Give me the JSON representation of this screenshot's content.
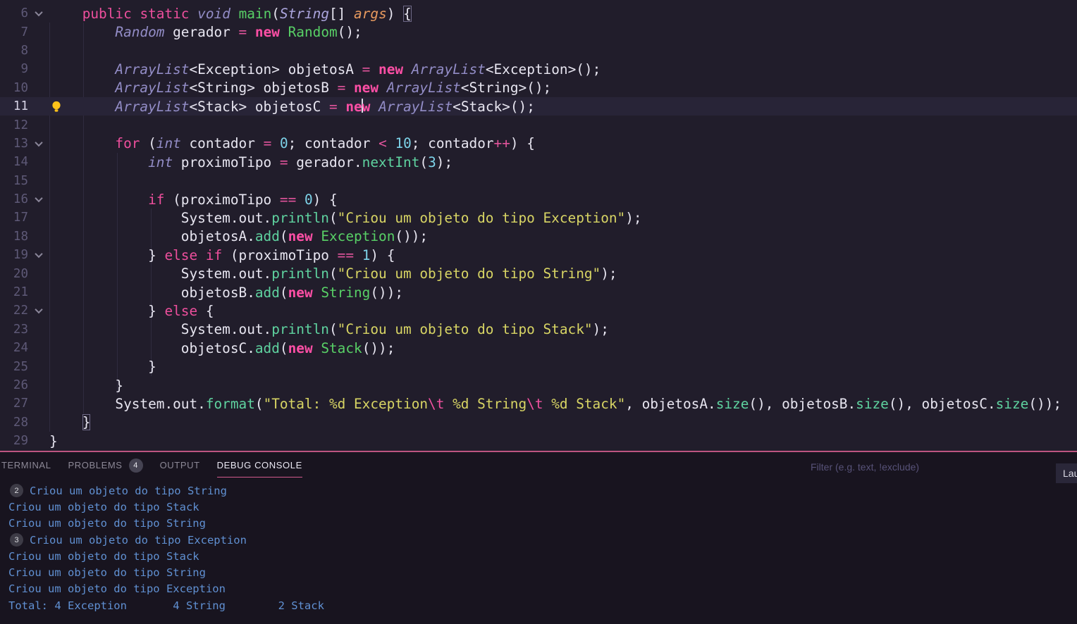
{
  "colors": {
    "editor_background": "#211d2b",
    "panel_background": "#18141f",
    "accent_pink": "#d15a8d",
    "panel_border_pink": "#bc5480",
    "keyword": "#ee4f9d",
    "keyword_bold": "#ff4fa6",
    "type_italic": "#938dc7",
    "function_green": "#58d066",
    "method_mint": "#5fd3a0",
    "string_yellow": "#d8d564",
    "number_cyan": "#7ed4ea",
    "console_text_blue": "#6090d2",
    "lightbulb_yellow": "#fdc21a"
  },
  "editor": {
    "lines": [
      {
        "num": "6",
        "fold": true,
        "segments": [
          [
            "    "
          ],
          [
            "public",
            "kw"
          ],
          [
            " "
          ],
          [
            "static",
            "kw"
          ],
          [
            " "
          ],
          [
            "void",
            "type"
          ],
          [
            " "
          ],
          [
            "main",
            "fn"
          ],
          [
            "("
          ],
          [
            "String",
            "type2"
          ],
          [
            "[]"
          ],
          [
            " "
          ],
          [
            "args",
            "param"
          ],
          [
            ")"
          ],
          [
            " "
          ],
          [
            "{",
            "boxed"
          ]
        ]
      },
      {
        "num": "7",
        "segments": [
          [
            "        "
          ],
          [
            "Random",
            "type"
          ],
          [
            " gerador "
          ],
          [
            "=",
            "op"
          ],
          [
            " "
          ],
          [
            "new",
            "kwb"
          ],
          [
            " "
          ],
          [
            "Random",
            "fn"
          ],
          [
            "();"
          ]
        ]
      },
      {
        "num": "8",
        "segments": []
      },
      {
        "num": "9",
        "segments": [
          [
            "        "
          ],
          [
            "ArrayList",
            "type"
          ],
          [
            "<Exception> objetosA "
          ],
          [
            "=",
            "op"
          ],
          [
            " "
          ],
          [
            "new",
            "kwb"
          ],
          [
            " "
          ],
          [
            "ArrayList",
            "type"
          ],
          [
            "<Exception>();"
          ]
        ]
      },
      {
        "num": "10",
        "segments": [
          [
            "        "
          ],
          [
            "ArrayList",
            "type"
          ],
          [
            "<String> objetosB "
          ],
          [
            "=",
            "op"
          ],
          [
            " "
          ],
          [
            "new",
            "kwb"
          ],
          [
            " "
          ],
          [
            "ArrayList",
            "type"
          ],
          [
            "<String>();"
          ]
        ]
      },
      {
        "num": "11",
        "active": true,
        "bulb": true,
        "segments": [
          [
            "        "
          ],
          [
            "ArrayList",
            "type"
          ],
          [
            "<Stack> objetosC "
          ],
          [
            "=",
            "op"
          ],
          [
            " "
          ],
          [
            "ne",
            "kwb"
          ],
          [
            "",
            "caret"
          ],
          [
            "w",
            "kwb"
          ],
          [
            " "
          ],
          [
            "ArrayList",
            "type"
          ],
          [
            "<Stack>();"
          ]
        ]
      },
      {
        "num": "12",
        "segments": []
      },
      {
        "num": "13",
        "fold": true,
        "segments": [
          [
            "        "
          ],
          [
            "for",
            "kw"
          ],
          [
            " ("
          ],
          [
            "int",
            "type"
          ],
          [
            " contador "
          ],
          [
            "=",
            "op"
          ],
          [
            " "
          ],
          [
            "0",
            "num"
          ],
          [
            "; contador "
          ],
          [
            "<",
            "op"
          ],
          [
            " "
          ],
          [
            "10",
            "num"
          ],
          [
            "; contador"
          ],
          [
            "++",
            "op"
          ],
          [
            ") {"
          ]
        ]
      },
      {
        "num": "14",
        "segments": [
          [
            "            "
          ],
          [
            "int",
            "type"
          ],
          [
            " proximoTipo "
          ],
          [
            "=",
            "op"
          ],
          [
            " gerador."
          ],
          [
            "nextInt",
            "mfn"
          ],
          [
            "("
          ],
          [
            "3",
            "num"
          ],
          [
            ");"
          ]
        ]
      },
      {
        "num": "15",
        "segments": []
      },
      {
        "num": "16",
        "fold": true,
        "segments": [
          [
            "            "
          ],
          [
            "if",
            "kw"
          ],
          [
            " (proximoTipo "
          ],
          [
            "==",
            "op"
          ],
          [
            " "
          ],
          [
            "0",
            "num"
          ],
          [
            ") {"
          ]
        ]
      },
      {
        "num": "17",
        "segments": [
          [
            "                "
          ],
          [
            "System.out."
          ],
          [
            "println",
            "mfn"
          ],
          [
            "("
          ],
          [
            "\"Criou um objeto do tipo Exception\"",
            "str"
          ],
          [
            ");"
          ]
        ]
      },
      {
        "num": "18",
        "segments": [
          [
            "                "
          ],
          [
            "objetosA."
          ],
          [
            "add",
            "mfn"
          ],
          [
            "("
          ],
          [
            "new",
            "kwb"
          ],
          [
            " "
          ],
          [
            "Exception",
            "fn"
          ],
          [
            "());"
          ]
        ]
      },
      {
        "num": "19",
        "fold": true,
        "segments": [
          [
            "            } "
          ],
          [
            "else",
            "kw"
          ],
          [
            " "
          ],
          [
            "if",
            "kw"
          ],
          [
            " (proximoTipo "
          ],
          [
            "==",
            "op"
          ],
          [
            " "
          ],
          [
            "1",
            "num"
          ],
          [
            ") {"
          ]
        ]
      },
      {
        "num": "20",
        "segments": [
          [
            "                "
          ],
          [
            "System.out."
          ],
          [
            "println",
            "mfn"
          ],
          [
            "("
          ],
          [
            "\"Criou um objeto do tipo String\"",
            "str"
          ],
          [
            ");"
          ]
        ]
      },
      {
        "num": "21",
        "segments": [
          [
            "                "
          ],
          [
            "objetosB."
          ],
          [
            "add",
            "mfn"
          ],
          [
            "("
          ],
          [
            "new",
            "kwb"
          ],
          [
            " "
          ],
          [
            "String",
            "fn"
          ],
          [
            "());"
          ]
        ]
      },
      {
        "num": "22",
        "fold": true,
        "segments": [
          [
            "            } "
          ],
          [
            "else",
            "kw"
          ],
          [
            " {"
          ]
        ]
      },
      {
        "num": "23",
        "segments": [
          [
            "                "
          ],
          [
            "System.out."
          ],
          [
            "println",
            "mfn"
          ],
          [
            "("
          ],
          [
            "\"Criou um objeto do tipo Stack\"",
            "str"
          ],
          [
            ");"
          ]
        ]
      },
      {
        "num": "24",
        "segments": [
          [
            "                "
          ],
          [
            "objetosC."
          ],
          [
            "add",
            "mfn"
          ],
          [
            "("
          ],
          [
            "new",
            "kwb"
          ],
          [
            " "
          ],
          [
            "Stack",
            "fn"
          ],
          [
            "());"
          ]
        ]
      },
      {
        "num": "25",
        "segments": [
          [
            "            }"
          ]
        ]
      },
      {
        "num": "26",
        "segments": [
          [
            "        }"
          ]
        ]
      },
      {
        "num": "27",
        "segments": [
          [
            "        "
          ],
          [
            "System.out."
          ],
          [
            "format",
            "mfn"
          ],
          [
            "("
          ],
          [
            "\"Total: %d Exception",
            "str"
          ],
          [
            "\\t",
            "esc"
          ],
          [
            " %d String",
            "str"
          ],
          [
            "\\t",
            "esc"
          ],
          [
            " %d Stack\"",
            "str"
          ],
          [
            ", objetosA."
          ],
          [
            "size",
            "mfn"
          ],
          [
            "(), objetosB."
          ],
          [
            "size",
            "mfn"
          ],
          [
            "(), objetosC."
          ],
          [
            "size",
            "mfn"
          ],
          [
            "());"
          ]
        ]
      },
      {
        "num": "28",
        "segments": [
          [
            "    "
          ],
          [
            "}",
            "boxed"
          ]
        ]
      },
      {
        "num": "29",
        "segments": [
          [
            "}"
          ]
        ]
      }
    ]
  },
  "panel": {
    "tabs": [
      {
        "label": "TERMINAL"
      },
      {
        "label": "PROBLEMS",
        "badge": "4"
      },
      {
        "label": "OUTPUT"
      },
      {
        "label": "DEBUG CONSOLE",
        "active": true
      }
    ],
    "filter_placeholder": "Filter (e.g. text, !exclude)",
    "launch_button": "Lau",
    "console": [
      {
        "badge": "2",
        "text": "Criou um objeto do tipo String"
      },
      {
        "text": "Criou um objeto do tipo Stack"
      },
      {
        "text": "Criou um objeto do tipo String"
      },
      {
        "badge": "3",
        "text": "Criou um objeto do tipo Exception"
      },
      {
        "text": "Criou um objeto do tipo Stack"
      },
      {
        "text": "Criou um objeto do tipo String"
      },
      {
        "text": "Criou um objeto do tipo Exception"
      },
      {
        "text": "Total: 4 Exception       4 String        2 Stack"
      }
    ]
  }
}
